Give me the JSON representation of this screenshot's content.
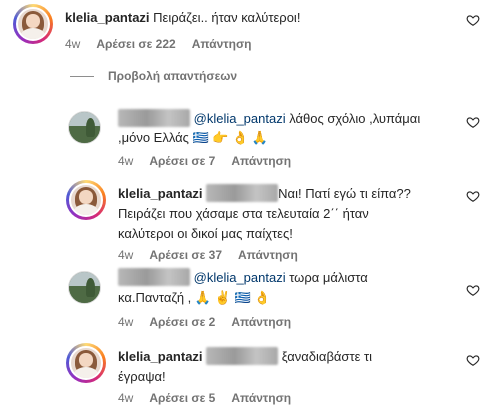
{
  "comments": [
    {
      "username": "klelia_pantazi",
      "text": "Πειράζει.. ήταν καλύτεροι!",
      "time": "4w",
      "likes": "Αρέσει σε 222",
      "reply": "Απάντηση"
    },
    {
      "mention": "@klelia_pantazi",
      "line1": "λάθος σχόλιο ,λυπάμαι",
      "line2": ",μόνο Ελλάς 🇬🇷 👉 👌 🙏",
      "time": "4w",
      "likes": "Αρέσει σε 7",
      "reply": "Απάντηση"
    },
    {
      "username": "klelia_pantazi",
      "line1": "Ναι! Πατί εγώ τι είπα??",
      "line2": "Πειράζει που χάσαμε στα τελευταία 2΄΄ ήταν",
      "line3": "καλύτεροι οι δικοί μας παίχτες!",
      "time": "4w",
      "likes": "Αρέσει σε 37",
      "reply": "Απάντηση"
    },
    {
      "mention": "@klelia_pantazi",
      "line1": "τωρα μάλιστα",
      "line2": "κα.Πανταζή , 🙏 ✌️ 🇬🇷 👌",
      "time": "4w",
      "likes": "Αρέσει σε 2",
      "reply": "Απάντηση"
    },
    {
      "username": "klelia_pantazi",
      "line1": "ξαναδιαβάστε τι",
      "line2": "έγραψα!",
      "time": "4w",
      "likes": "Αρέσει σε 5",
      "reply": "Απάντηση"
    }
  ],
  "view_replies": "Προβολή απαντήσεων",
  "icons": {
    "like": "heart-outline-icon"
  },
  "colors": {
    "text": "#262626",
    "secondary": "#737373",
    "mention": "#00376b"
  }
}
